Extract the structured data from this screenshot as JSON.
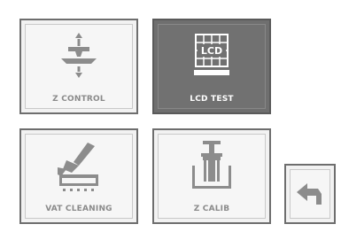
{
  "tiles": {
    "z_control": {
      "label": "Z CONTROL",
      "icon": "z-axis-icon"
    },
    "lcd_test": {
      "label": "LCD TEST",
      "icon": "lcd-grid-icon",
      "icon_text": "LCD"
    },
    "vat_cleaning": {
      "label": "VAT CLEANING",
      "icon": "vat-brush-icon"
    },
    "z_calib": {
      "label": "Z CALIB",
      "icon": "z-calibration-icon"
    }
  },
  "back": {
    "icon": "back-arrow-icon"
  },
  "colors": {
    "tile_border": "#6e6e6e",
    "tile_bg": "#f2f2f2",
    "active_bg": "#6f6f6f",
    "label_gray": "#8a8a8a",
    "icon_gray": "#8c8c8c",
    "active_text": "#ffffff"
  }
}
